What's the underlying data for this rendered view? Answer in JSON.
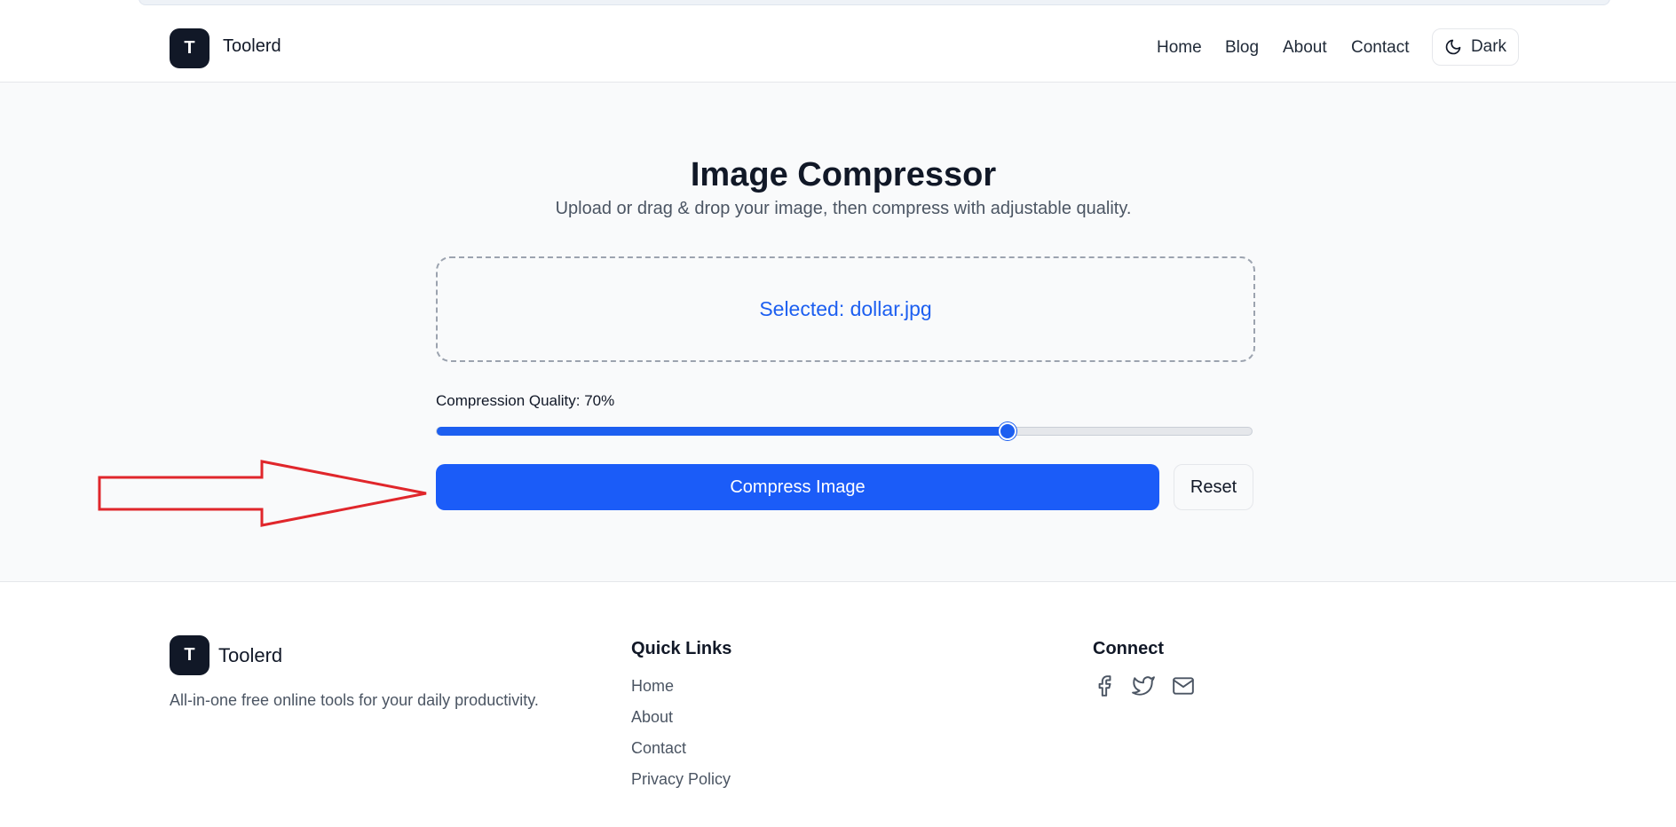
{
  "header": {
    "logo_letter": "T",
    "brand": "Toolerd",
    "nav": [
      "Home",
      "Blog",
      "About",
      "Contact"
    ],
    "theme_toggle": {
      "icon": "moon-icon",
      "label": "Dark"
    }
  },
  "main": {
    "title": "Image Compressor",
    "subtitle": "Upload or drag & drop your image, then compress with adjustable quality.",
    "dropzone_text": "Selected: dollar.jpg",
    "quality_label": "Compression Quality: 70%",
    "quality_value": 70,
    "compress_label": "Compress Image",
    "reset_label": "Reset"
  },
  "footer": {
    "logo_letter": "T",
    "brand": "Toolerd",
    "tagline": "All-in-one free online tools for your daily productivity.",
    "quick_links_heading": "Quick Links",
    "quick_links": [
      "Home",
      "About",
      "Contact",
      "Privacy Policy"
    ],
    "connect_heading": "Connect",
    "social_icons": [
      "facebook-icon",
      "twitter-icon",
      "mail-icon"
    ]
  },
  "colors": {
    "accent": "#1b5cf8",
    "dark": "#111827",
    "annotation_arrow": "#e0262b"
  }
}
